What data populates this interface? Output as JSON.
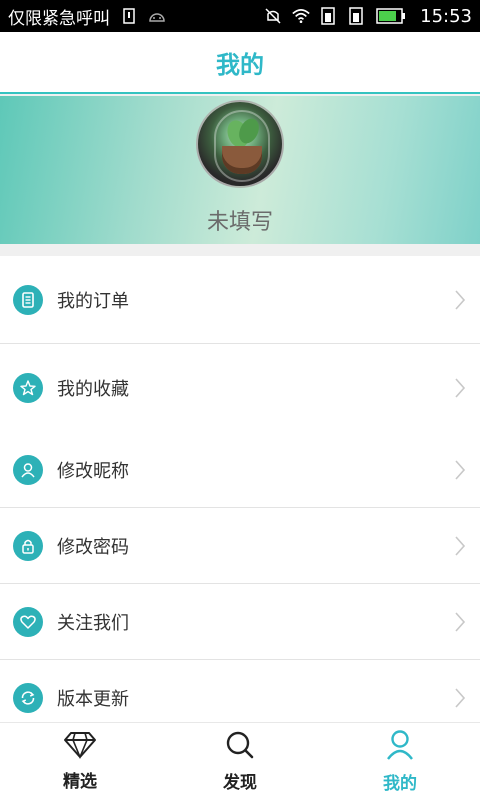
{
  "status_bar": {
    "carrier": "仅限紧急呼叫",
    "time": "15:53",
    "icons": [
      "sim-icon",
      "android-icon",
      "mute-icon",
      "wifi-icon",
      "sim1-icon",
      "sim2-icon",
      "battery-icon"
    ]
  },
  "header": {
    "title": "我的"
  },
  "profile": {
    "username": "未填写",
    "avatar": "avatar-image"
  },
  "menu": {
    "group1": [
      {
        "label": "我的订单",
        "icon": "order-icon"
      },
      {
        "label": "我的收藏",
        "icon": "star-icon"
      }
    ],
    "group2": [
      {
        "label": "修改昵称",
        "icon": "user-icon"
      },
      {
        "label": "修改密码",
        "icon": "lock-icon"
      },
      {
        "label": "关注我们",
        "icon": "heart-icon"
      },
      {
        "label": "版本更新",
        "icon": "refresh-icon"
      }
    ]
  },
  "bottom_nav": {
    "items": [
      {
        "label": "精选",
        "icon": "diamond-icon"
      },
      {
        "label": "发现",
        "icon": "search-icon"
      },
      {
        "label": "我的",
        "icon": "person-icon",
        "active": true
      }
    ]
  },
  "colors": {
    "accent": "#2fb8c8",
    "icon_bg": "#2db1b7"
  }
}
